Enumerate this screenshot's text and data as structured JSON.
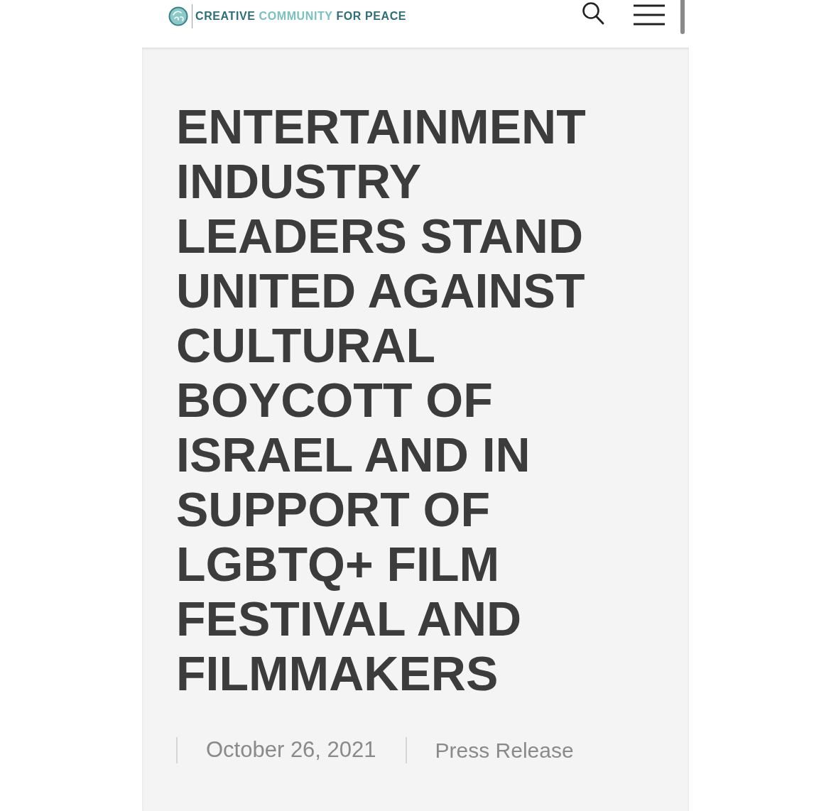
{
  "header": {
    "logo": {
      "parts": [
        {
          "text": "CREATIVE",
          "accent": false
        },
        {
          "text": "COMMUNITY",
          "accent": true
        },
        {
          "text": "FOR PEACE",
          "accent": false
        }
      ]
    }
  },
  "article": {
    "title": "ENTERTAINMENT INDUSTRY LEADERS STAND UNITED AGAINST CULTURAL BOYCOTT OF ISRAEL AND IN SUPPORT OF LGBTQ+ FILM FESTIVAL AND FILMMAKERS",
    "date": "October 26, 2021",
    "category": "Press Release"
  }
}
